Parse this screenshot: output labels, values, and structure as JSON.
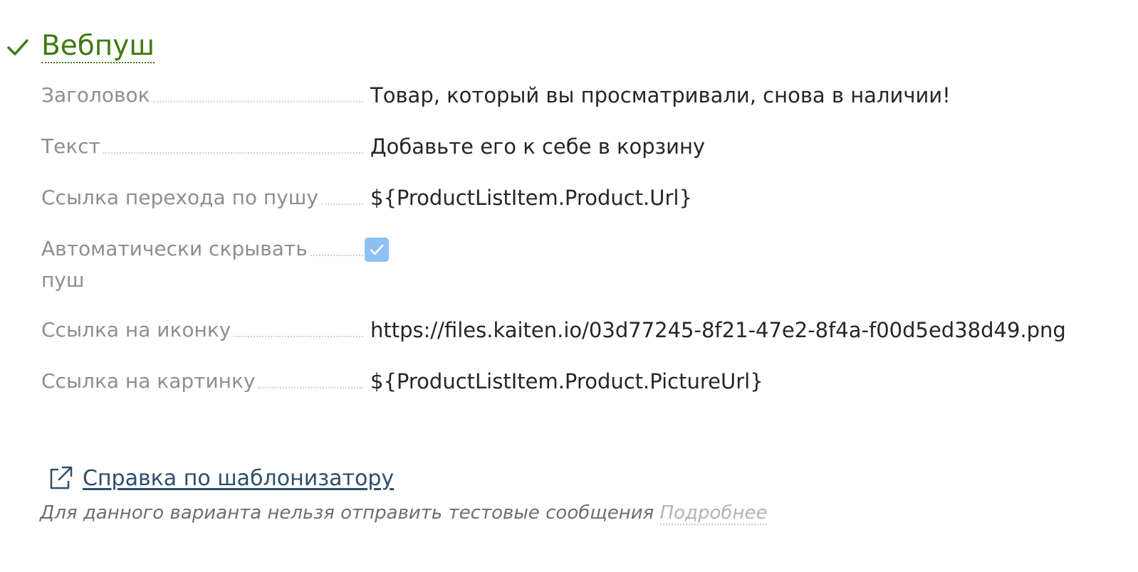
{
  "section": {
    "title": "Вебпуш",
    "status_icon": "check-icon"
  },
  "fields": [
    {
      "label": "Заголовок",
      "value": "Товар, который вы просматривали, снова в наличии!"
    },
    {
      "label": "Текст",
      "value": "Добавьте его к себе в корзину"
    },
    {
      "label": "Ссылка перехода по пушу",
      "value": "${ProductListItem.Product.Url}"
    },
    {
      "label_line1": "Автоматически скрывать",
      "label_line2": "пуш",
      "checked": true
    },
    {
      "label": "Ссылка на иконку",
      "value": "https://files.kaiten.io/03d77245-8f21-47e2-8f4a-f00d5ed38d49.png"
    },
    {
      "label": "Ссылка на картинку",
      "value": "${ProductListItem.Product.PictureUrl}"
    }
  ],
  "help": {
    "link_label": "Справка по шаблонизатору",
    "icon": "external-link-icon"
  },
  "note": {
    "text": "Для данного варианта нельзя отправить тестовые сообщения",
    "link_label": "Подробнее"
  },
  "colors": {
    "title_green": "#3f7a12",
    "checkbox_blue": "#8fc0f2",
    "link_blue": "#2d4e6b",
    "label_gray": "#8e8e8e"
  }
}
